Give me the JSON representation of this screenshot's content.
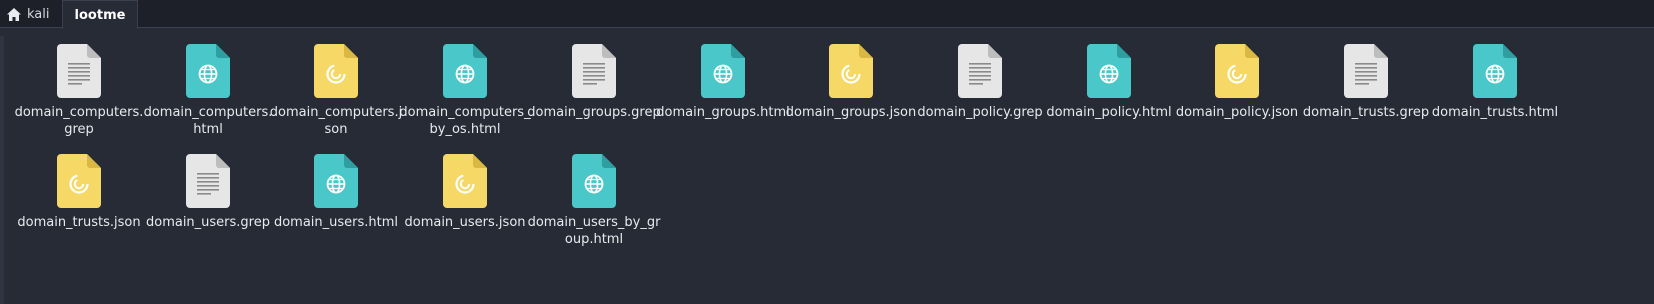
{
  "breadcrumbs": [
    {
      "label": "kali",
      "icon": "home-icon"
    },
    {
      "label": "lootme"
    }
  ],
  "colors": {
    "background": "#262b36",
    "text_icon": "#e6e6e6",
    "html_icon": "#4ac7c9",
    "json_icon": "#f5d866"
  },
  "files": [
    {
      "name": "domain_computers​.grep",
      "type": "text"
    },
    {
      "name": "domain_computers​.html",
      "type": "html"
    },
    {
      "name": "domain_computers​.json",
      "type": "json"
    },
    {
      "name": "domain_computers​_by_os.html",
      "type": "html"
    },
    {
      "name": "domain_groups.gre​p",
      "type": "text"
    },
    {
      "name": "domain_groups.ht​ml",
      "type": "html"
    },
    {
      "name": "domain_groups.jso​n",
      "type": "json"
    },
    {
      "name": "domain_policy.grep",
      "type": "text"
    },
    {
      "name": "domain_policy.html",
      "type": "html"
    },
    {
      "name": "domain_policy.json",
      "type": "json"
    },
    {
      "name": "domain_trusts.grep",
      "type": "text"
    },
    {
      "name": "domain_trusts.html",
      "type": "html"
    },
    {
      "name": "domain_trusts.json",
      "type": "json"
    },
    {
      "name": "domain_users.grep",
      "type": "text"
    },
    {
      "name": "domain_users.html",
      "type": "html"
    },
    {
      "name": "domain_users.json",
      "type": "json"
    },
    {
      "name": "domain_users_by_​group.html",
      "type": "html"
    }
  ]
}
